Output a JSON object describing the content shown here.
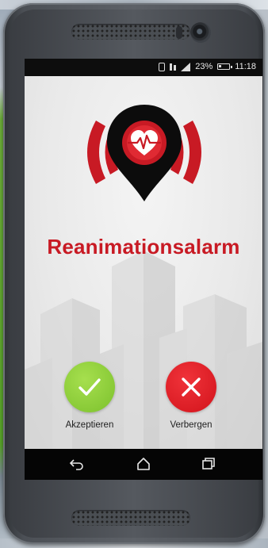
{
  "statusbar": {
    "battery_percent": "23%",
    "time": "11:18",
    "icons": [
      "vibrate-icon",
      "data-icon",
      "signal-icon",
      "battery-icon"
    ]
  },
  "app": {
    "logo_icon": "heart-pulse-alarm-icon",
    "title": "Reanimationsalarm",
    "accept_label": "Akzeptieren",
    "hide_label": "Verbergen",
    "accept_icon": "check-icon",
    "hide_icon": "close-icon"
  },
  "navbar": {
    "icons": [
      "back-icon",
      "home-icon",
      "recent-apps-icon"
    ]
  },
  "colors": {
    "brand_red": "#c81a24",
    "accept_green": "#8fd03a",
    "reject_red": "#e0191f"
  }
}
